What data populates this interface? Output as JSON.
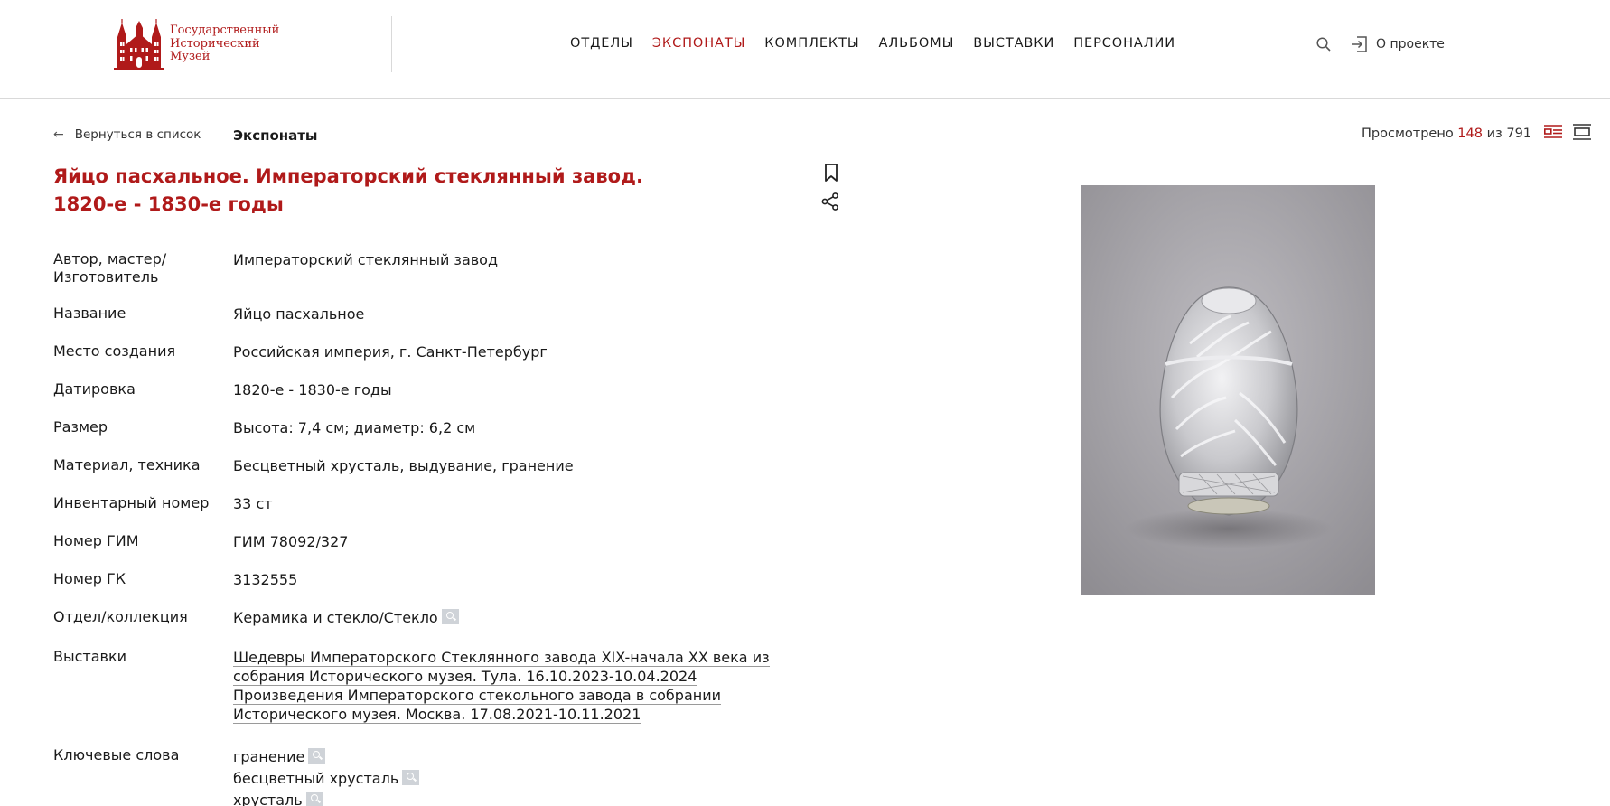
{
  "header": {
    "logo_lines": [
      "Государственный",
      "Исторический",
      "Музей"
    ],
    "nav": [
      "ОТДЕЛЫ",
      "ЭКСПОНАТЫ",
      "КОМПЛЕКТЫ",
      "АЛЬБОМЫ",
      "ВЫСТАВКИ",
      "ПЕРСОНАЛИИ"
    ],
    "active_nav": "ЭКСПОНАТЫ",
    "about_label": "О проекте",
    "search_icon": "search-icon",
    "login_icon": "login-icon"
  },
  "subbar": {
    "back_label": "Вернуться в список",
    "breadcrumb": "Экспонаты",
    "viewed_prefix": "Просмотрено",
    "viewed_current": "148",
    "viewed_sep": "из",
    "viewed_total": "791"
  },
  "item": {
    "title": "Яйцо пасхальное. Императорский стеклянный завод. 1820-е - 1830-е годы",
    "properties": [
      {
        "key": "Автор, мастер/ Изготовитель",
        "value": "Императорский стеклянный завод"
      },
      {
        "key": "Название",
        "value": "Яйцо пасхальное"
      },
      {
        "key": "Место создания",
        "value": "Российская империя, г. Санкт-Петербург"
      },
      {
        "key": "Датировка",
        "value": "1820-е - 1830-е годы"
      },
      {
        "key": "Размер",
        "value": "Высота: 7,4 см; диаметр: 6,2 см"
      },
      {
        "key": "Материал, техника",
        "value": "Бесцветный хрусталь, выдувание, гранение"
      },
      {
        "key": "Инвентарный номер",
        "value": "33 ст"
      },
      {
        "key": "Номер ГИМ",
        "value": "ГИМ 78092/327"
      },
      {
        "key": "Номер ГК",
        "value": "3132555"
      },
      {
        "key": "Отдел/коллекция",
        "value": "Керамика и стекло/Стекло"
      }
    ],
    "exhibitions_key": "Выставки",
    "exhibitions": [
      "Шедевры Императорского Стеклянного завода XIX-начала XX века из собрания Исторического музея. Тула. 16.10.2023-10.04.2024",
      "Произведения Императорского стекольного завода в собрании Исторического музея. Москва. 17.08.2021-10.11.2021"
    ],
    "keywords_key": "Ключевые слова",
    "keywords": [
      "гранение",
      "бесцветный хрусталь",
      "хрусталь"
    ]
  },
  "colors": {
    "accent": "#b01a1a",
    "divider": "#d9d9d9",
    "magnifier_bg": "#cfd3d8"
  }
}
